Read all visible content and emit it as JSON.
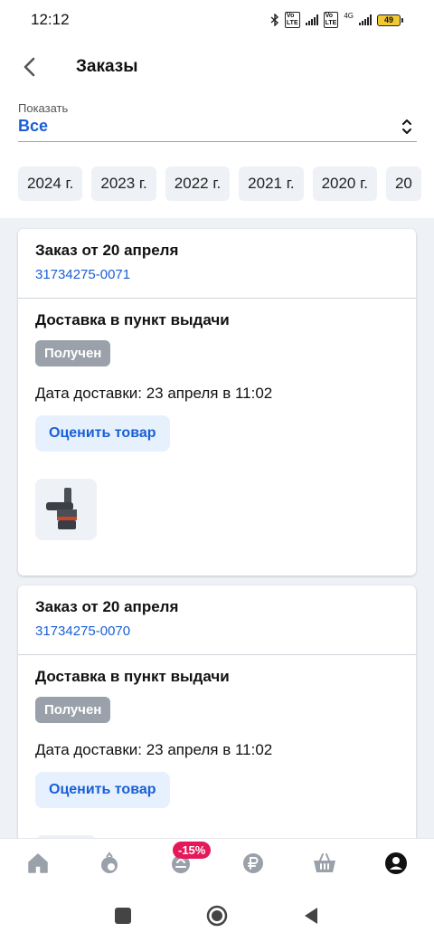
{
  "status_bar": {
    "time": "12:12",
    "network_small": "4G",
    "battery": "49"
  },
  "header": {
    "title": "Заказы"
  },
  "filter": {
    "label": "Показать",
    "value": "Все"
  },
  "years": [
    "2024 г.",
    "2023 г.",
    "2022 г.",
    "2021 г.",
    "2020 г.",
    "20"
  ],
  "orders": [
    {
      "title": "Заказ от 20 апреля",
      "number": "31734275-0071",
      "delivery_type": "Доставка в пункт выдачи",
      "status": "Получен",
      "delivery_date": "Дата доставки: 23 апреля в 11:02",
      "rate_label": "Оценить товар"
    },
    {
      "title": "Заказ от 20 апреля",
      "number": "31734275-0070",
      "delivery_type": "Доставка в пункт выдачи",
      "status": "Получен",
      "delivery_date": "Дата доставки: 23 апреля в 11:02",
      "rate_label": "Оценить товар"
    }
  ],
  "bottom_nav": {
    "items": [
      "home-icon",
      "catalog-icon",
      "promo-icon",
      "ruble-icon",
      "basket-icon",
      "profile-icon"
    ],
    "promo_badge": "-15%",
    "active": "profile-icon"
  },
  "colors": {
    "accent": "#1a5fd6",
    "badge": "#e5185a",
    "status_gray": "#9aa1aa"
  }
}
